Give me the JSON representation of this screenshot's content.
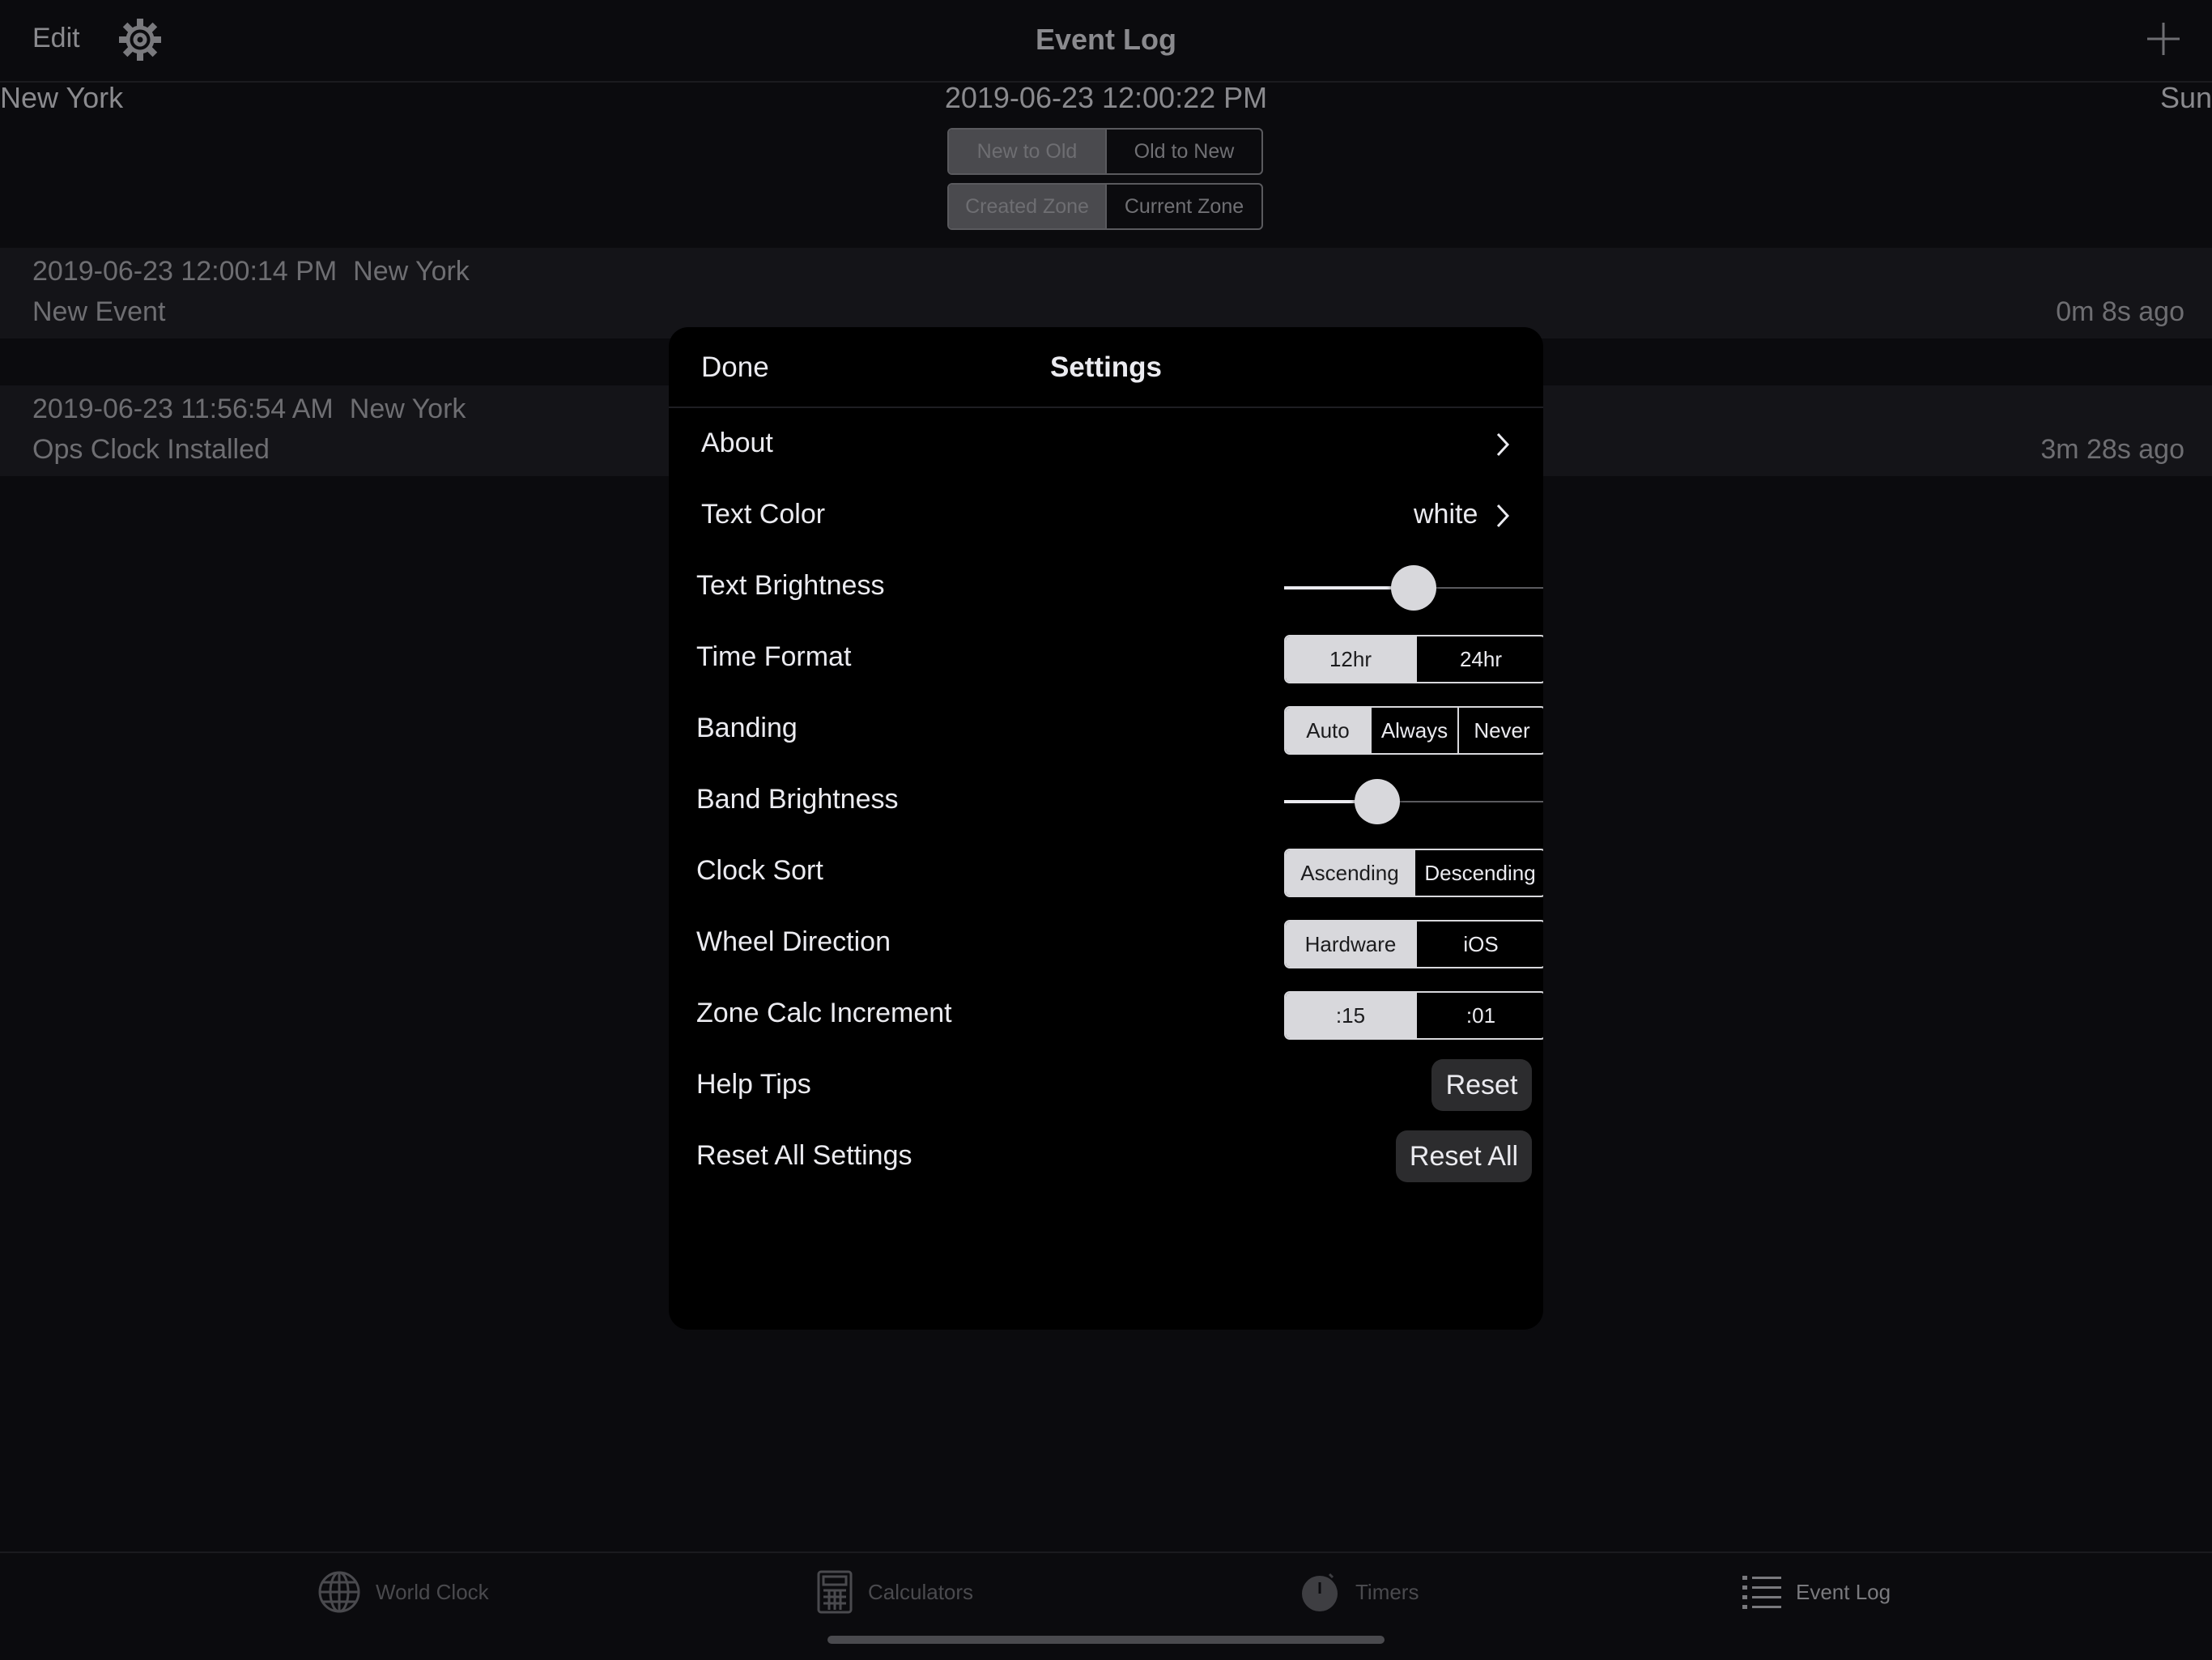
{
  "navbar": {
    "edit_label": "Edit",
    "title": "Event Log",
    "gear_icon": "gear-icon",
    "add_icon": "plus-icon"
  },
  "clock": {
    "city": "New York",
    "time": "2019-06-23 12:00:22 PM",
    "day": "Sun"
  },
  "sort_order": {
    "options": [
      "New to Old",
      "Old to New"
    ],
    "selected": "New to Old"
  },
  "zone_mode": {
    "options": [
      "Created Zone",
      "Current Zone"
    ],
    "selected": "Created Zone"
  },
  "events": [
    {
      "timestamp": "2019-06-23 12:00:14 PM",
      "city": "New York",
      "title": "New Event",
      "ago": "0m 8s ago"
    },
    {
      "timestamp": "2019-06-23 11:56:54 AM",
      "city": "New York",
      "title": "Ops Clock Installed",
      "ago": "3m 28s ago"
    }
  ],
  "settings": {
    "done_label": "Done",
    "title": "Settings",
    "about_label": "About",
    "text_color": {
      "label": "Text Color",
      "value": "white"
    },
    "text_brightness": {
      "label": "Text Brightness",
      "level": 0.5
    },
    "time_format": {
      "label": "Time Format",
      "options": [
        "12hr",
        "24hr"
      ],
      "selected": "12hr"
    },
    "banding": {
      "label": "Banding",
      "options": [
        "Auto",
        "Always",
        "Never"
      ],
      "selected": "Auto"
    },
    "band_brightness": {
      "label": "Band Brightness",
      "level": 0.36
    },
    "clock_sort": {
      "label": "Clock Sort",
      "options": [
        "Ascending",
        "Descending"
      ],
      "selected": "Ascending"
    },
    "wheel_direction": {
      "label": "Wheel Direction",
      "options": [
        "Hardware",
        "iOS"
      ],
      "selected": "Hardware"
    },
    "zone_calc_increment": {
      "label": "Zone Calc Increment",
      "options": [
        ":15",
        ":01"
      ],
      "selected": ":15"
    },
    "help_tips": {
      "label": "Help Tips",
      "button_label": "Reset"
    },
    "reset_all": {
      "label": "Reset All Settings",
      "button_label": "Reset All"
    }
  },
  "tabbar": {
    "tabs": [
      {
        "label": "World Clock",
        "icon": "globe-icon"
      },
      {
        "label": "Calculators",
        "icon": "calculator-icon"
      },
      {
        "label": "Timers",
        "icon": "timer-icon"
      },
      {
        "label": "Event Log",
        "icon": "list-icon"
      }
    ],
    "active": "Event Log"
  }
}
